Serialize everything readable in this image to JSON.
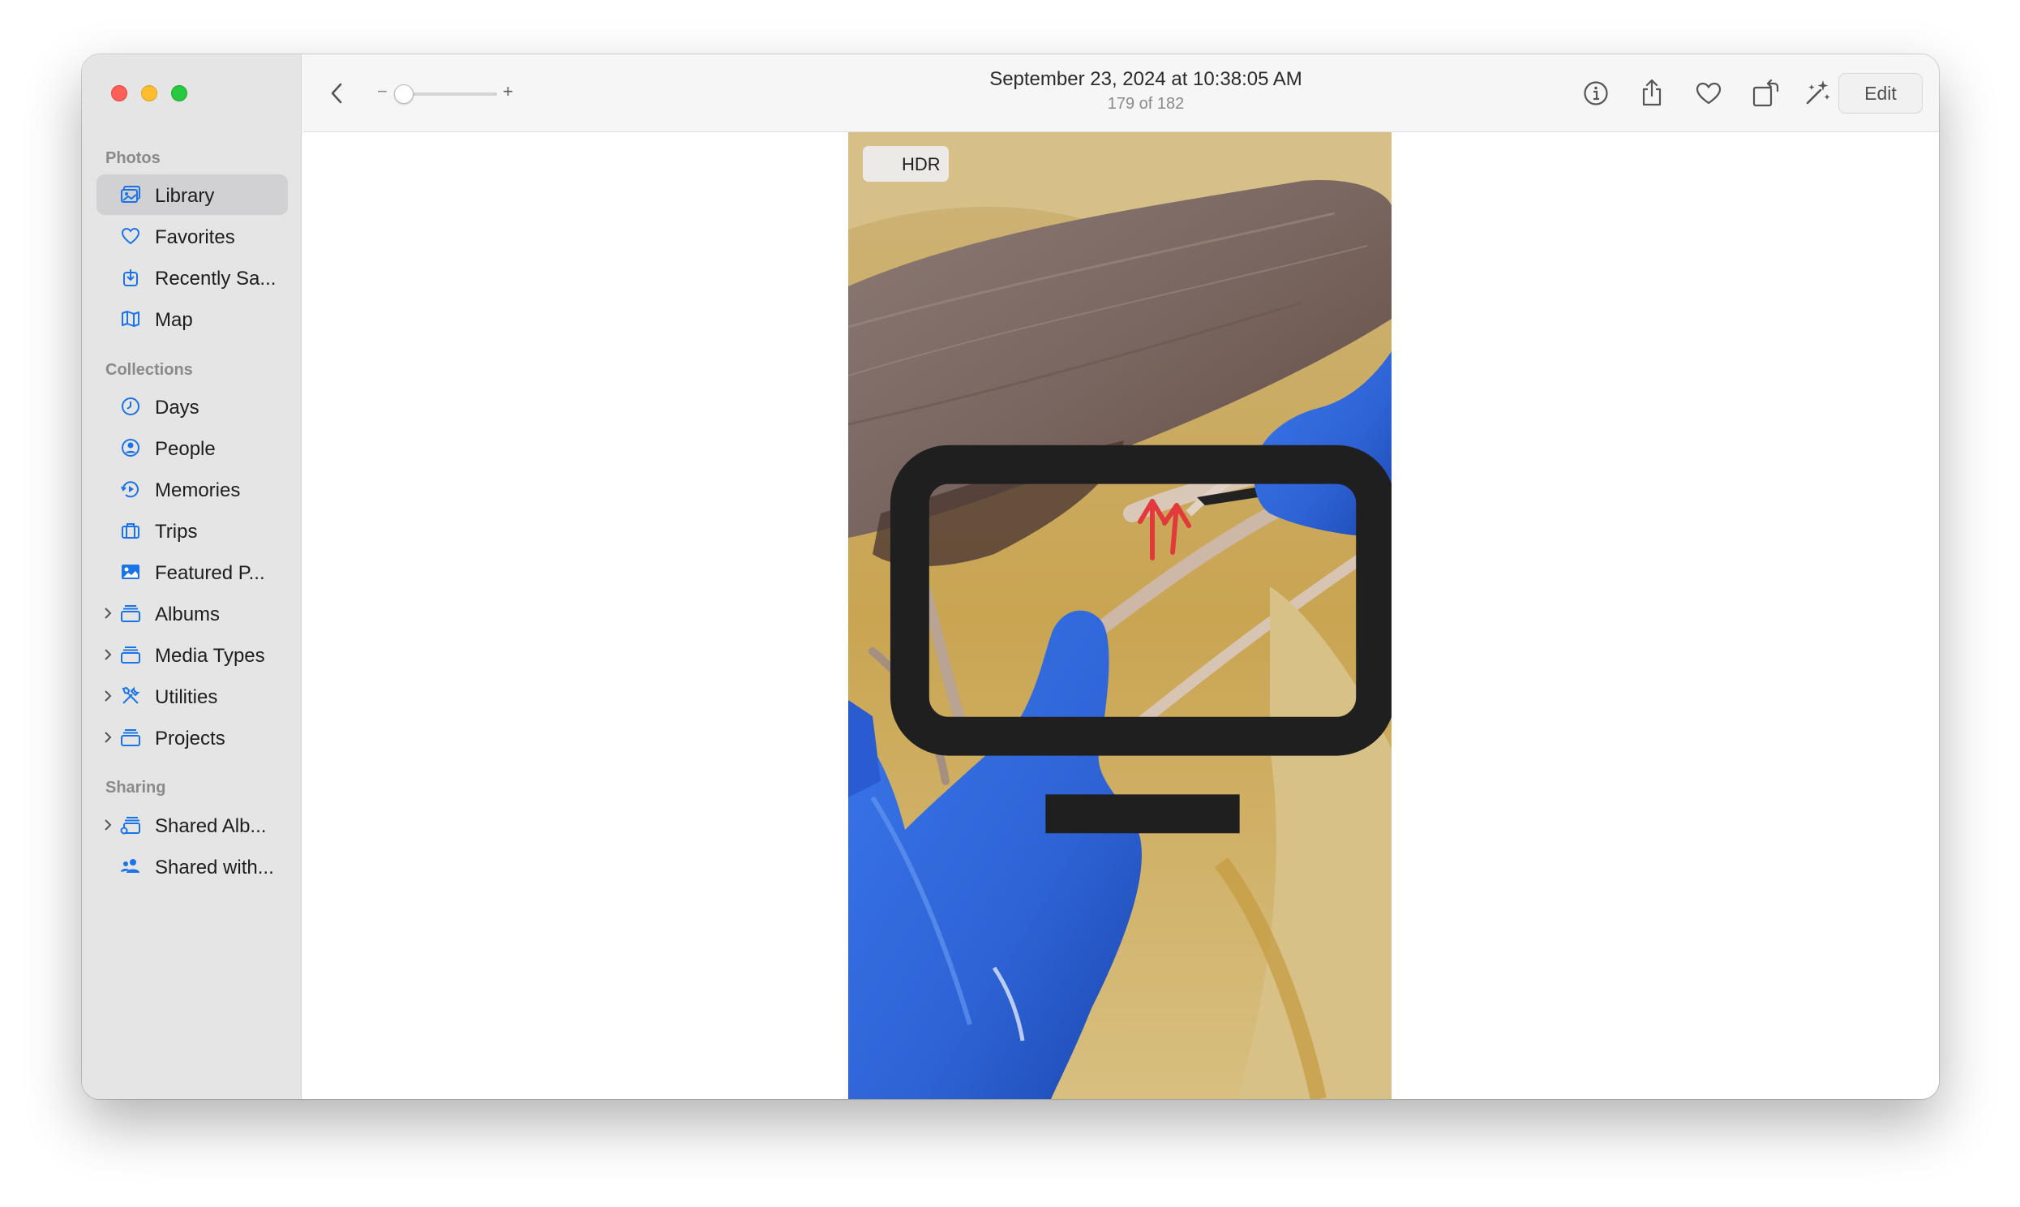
{
  "window": {
    "title": "September 23, 2024 at 10:38:05 AM",
    "subtitle": "179 of 182"
  },
  "toolbar": {
    "zoom_minus": "−",
    "zoom_plus": "+",
    "zoom_level": 0.0,
    "edit_label": "Edit",
    "icons": [
      "back-chevron-icon",
      "info-icon",
      "share-icon",
      "heart-icon",
      "rotate-icon",
      "magic-wand-icon"
    ]
  },
  "sidebar": {
    "sections": [
      {
        "header": "Photos"
      },
      {
        "header": "Collections"
      },
      {
        "header": "Sharing"
      }
    ],
    "items": [
      {
        "label": "Library",
        "icon": "library-icon",
        "active": true
      },
      {
        "label": "Favorites",
        "icon": "heart-icon"
      },
      {
        "label": "Recently Sa...",
        "icon": "recently-saved-icon"
      },
      {
        "label": "Map",
        "icon": "map-icon"
      },
      {
        "label": "Days",
        "icon": "clock-icon"
      },
      {
        "label": "People",
        "icon": "person-circle-icon"
      },
      {
        "label": "Memories",
        "icon": "memories-icon"
      },
      {
        "label": "Trips",
        "icon": "suitcase-icon"
      },
      {
        "label": "Featured P...",
        "icon": "photo-icon"
      },
      {
        "label": "Albums",
        "icon": "folder-stack-icon",
        "expandable": true
      },
      {
        "label": "Media Types",
        "icon": "folder-stack-icon",
        "expandable": true
      },
      {
        "label": "Utilities",
        "icon": "tools-icon",
        "expandable": true
      },
      {
        "label": "Projects",
        "icon": "folder-stack-icon",
        "expandable": true
      },
      {
        "label": "Shared Alb...",
        "icon": "shared-album-icon",
        "expandable": true
      },
      {
        "label": "Shared with...",
        "icon": "people-icon"
      }
    ]
  },
  "photo": {
    "badge": "HDR",
    "badge_icon": "display-icon",
    "colors": {
      "glove": "#2e63d6",
      "arrow": "#e23a3a",
      "tissue": "#c9a552"
    }
  },
  "colors": {
    "accent": "#1a73e8",
    "sidebar_bg": "#e6e5e6",
    "selection": "#d1d0d2"
  }
}
